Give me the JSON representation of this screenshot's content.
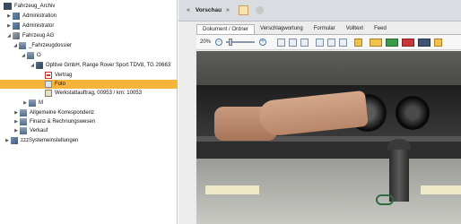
{
  "tree": {
    "items": [
      {
        "label": "Fahrzeug_Archiv",
        "expander": "",
        "icon": "archive-icon"
      },
      {
        "label": "Administration",
        "expander": "▶",
        "icon": "admin-icon"
      },
      {
        "label": "Administrator",
        "expander": "▶",
        "icon": "admin-icon"
      },
      {
        "label": "Fahrzeug AG",
        "expander": "◢",
        "icon": "company-icon"
      },
      {
        "label": "_Fahrzeugdossier",
        "expander": "◢",
        "icon": "folder-icon"
      },
      {
        "label": "O",
        "expander": "◢",
        "icon": "folder-icon"
      },
      {
        "label": "Opltive GmbH, Range Rover Sport TDV8, TG 20663",
        "expander": "◢",
        "icon": "car-icon"
      },
      {
        "label": "Vertrag",
        "expander": "",
        "icon": "contract-icon"
      },
      {
        "label": "Foto",
        "expander": "",
        "icon": "photo-icon"
      },
      {
        "label": "Werkstattauftrag, 00953 / km: 10053",
        "expander": "",
        "icon": "workshop-order-icon"
      },
      {
        "label": "M",
        "expander": "▶",
        "icon": "folder-icon"
      },
      {
        "label": "Allgemeine Korrespondenz",
        "expander": "▶",
        "icon": "folder-icon"
      },
      {
        "label": "Finanz & Rechnungswesen",
        "expander": "▶",
        "icon": "folder-icon"
      },
      {
        "label": "Verkauf",
        "expander": "▶",
        "icon": "folder-icon"
      },
      {
        "label": "zzzSystemeinstellungen",
        "expander": "▶",
        "icon": "settings-folder-icon"
      }
    ],
    "selected_index": 8
  },
  "preview": {
    "nav_back": "«",
    "title": "Vorschau",
    "nav_forward": "»",
    "tabs": [
      "Dokument / Ordner",
      "Verschlagwortung",
      "Formular",
      "Volltext",
      "Feed"
    ],
    "active_tab": 0,
    "zoom": "20%",
    "zoom_out": "−",
    "zoom_in": "+"
  },
  "colors": {
    "selection": "#f6b43a",
    "header_bg": "#d9dde2"
  }
}
